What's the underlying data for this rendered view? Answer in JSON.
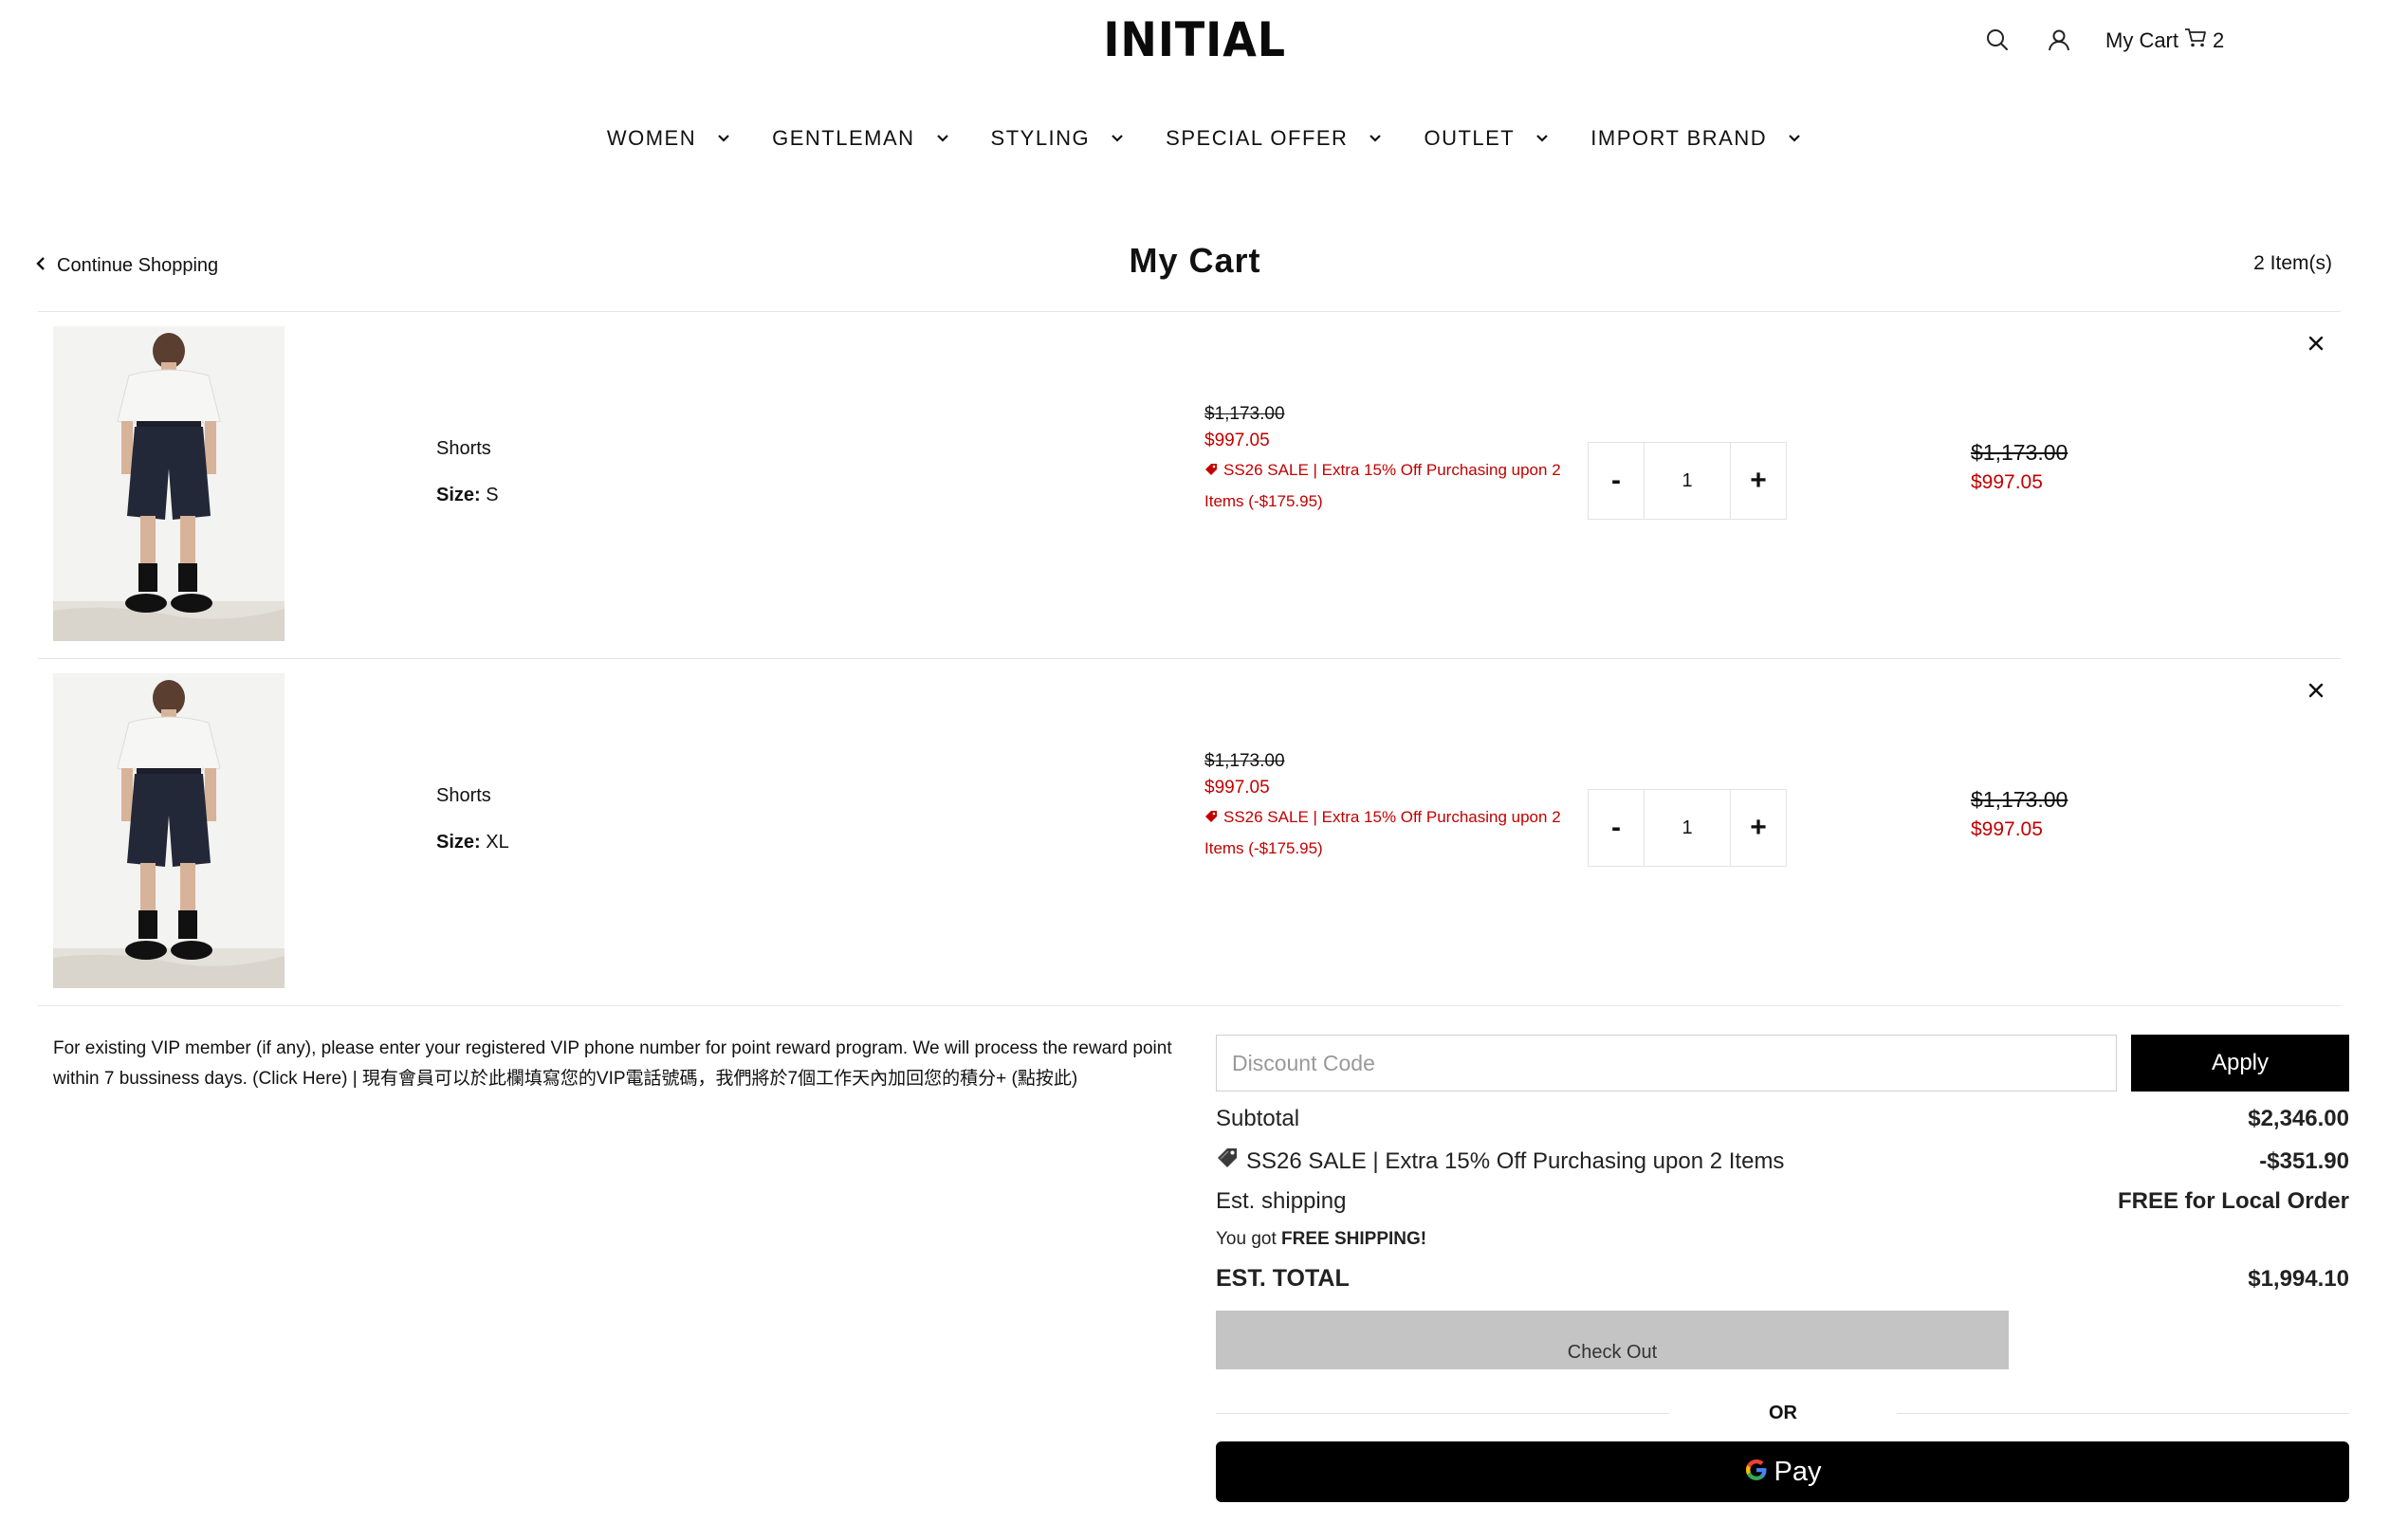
{
  "header": {
    "logo_text": "INITIAL",
    "cart_label": "My Cart",
    "cart_count": "2",
    "icons": [
      "search-icon",
      "user-icon",
      "cart-icon"
    ]
  },
  "nav": {
    "items": [
      {
        "label": "WOMEN"
      },
      {
        "label": "GENTLEMAN"
      },
      {
        "label": "STYLING"
      },
      {
        "label": "SPECIAL OFFER"
      },
      {
        "label": "OUTLET"
      },
      {
        "label": "IMPORT BRAND"
      }
    ]
  },
  "cart": {
    "continue_label": "Continue Shopping",
    "title": "My Cart",
    "item_count": "2 Item(s)",
    "items": [
      {
        "name": "Shorts",
        "size_label": "Size:",
        "size_value": "S",
        "original_price": "$1,173.00",
        "sale_price": "$997.05",
        "promo": "SS26 SALE | Extra 15% Off Purchasing upon 2 Items (-$175.95)",
        "quantity": "1",
        "qty_minus": "-",
        "qty_plus": "+",
        "line_original": "$1,173.00",
        "line_sale": "$997.05"
      },
      {
        "name": "Shorts",
        "size_label": "Size:",
        "size_value": "XL",
        "original_price": "$1,173.00",
        "sale_price": "$997.05",
        "promo": "SS26 SALE | Extra 15% Off Purchasing upon 2 Items (-$175.95)",
        "quantity": "1",
        "qty_minus": "-",
        "qty_plus": "+",
        "line_original": "$1,173.00",
        "line_sale": "$997.05"
      }
    ]
  },
  "vip_note": "For existing VIP member (if any), please enter your registered VIP phone number for point reward program. We will process the reward point within 7 bussiness days. (Click Here) | 現有會員可以於此欄填寫您的VIP電話號碼，我們將於7個工作天內加回您的積分+ (點按此)",
  "discount": {
    "placeholder": "Discount Code",
    "apply_label": "Apply"
  },
  "summary": {
    "subtotal_label": "Subtotal",
    "subtotal_value": "$2,346.00",
    "discount_label": "SS26 SALE | Extra 15% Off Purchasing upon 2 Items",
    "discount_value": "-$351.90",
    "shipping_label": "Est. shipping",
    "shipping_value": "FREE for Local Order",
    "free_note_prefix": "You got",
    "free_note_bold": "FREE SHIPPING!",
    "total_label": "EST. TOTAL",
    "total_value": "$1,994.10"
  },
  "checkout": {
    "checkout_label": "Check Out",
    "or_label": "OR",
    "gpay_label": "Pay"
  },
  "colors": {
    "sale_red": "#c20000",
    "apply_bg": "#000000",
    "checkout_bg": "#c4c4c4"
  }
}
